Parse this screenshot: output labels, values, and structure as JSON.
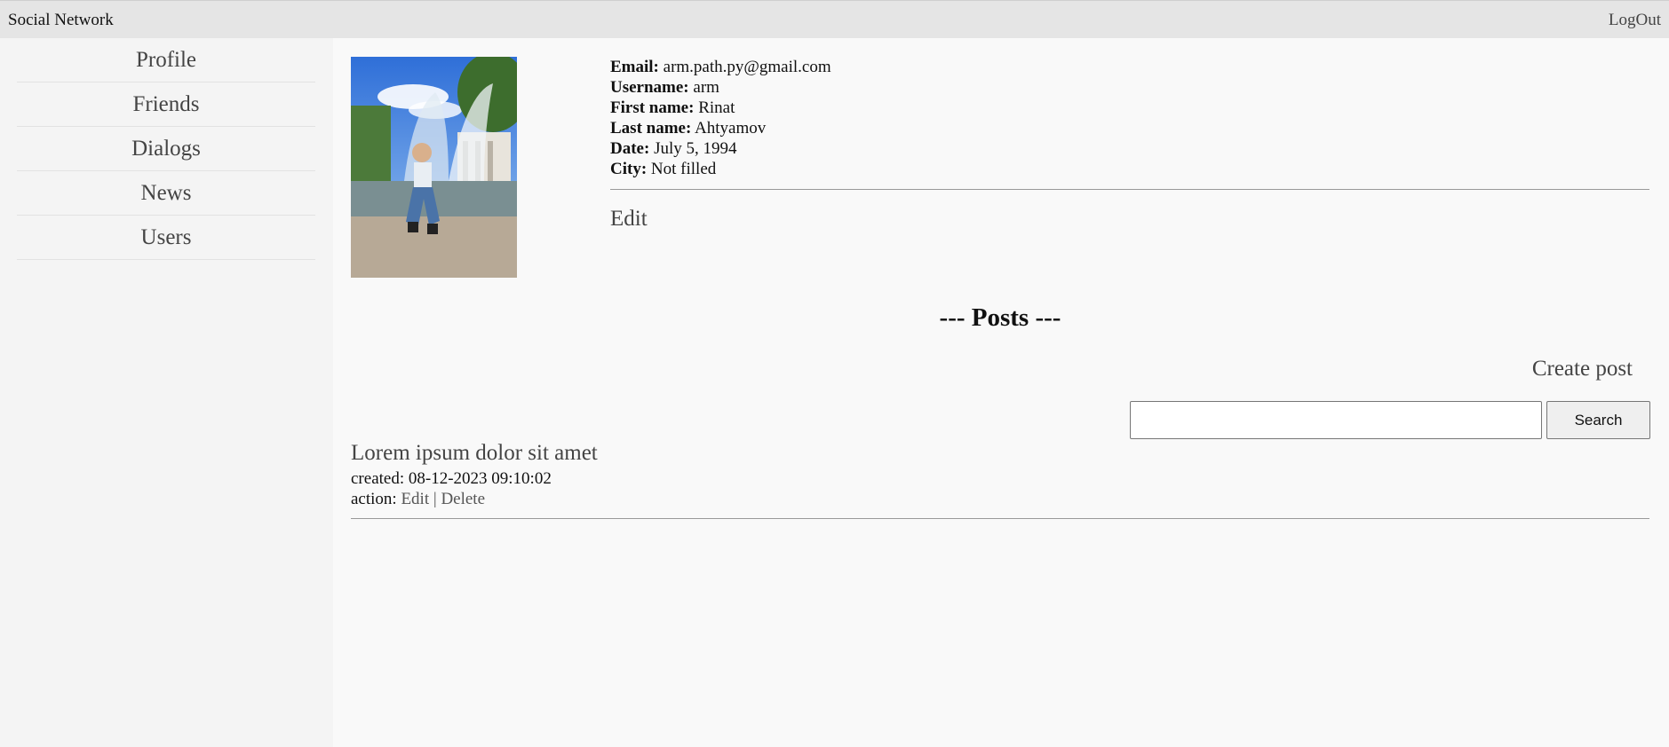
{
  "header": {
    "brand": "Social Network",
    "logout_label": "LogOut"
  },
  "sidebar": {
    "items": [
      {
        "label": "Profile"
      },
      {
        "label": "Friends"
      },
      {
        "label": "Dialogs"
      },
      {
        "label": "News"
      },
      {
        "label": "Users"
      }
    ]
  },
  "profile": {
    "email_label": "Email:",
    "email": "arm.path.py@gmail.com",
    "username_label": "Username:",
    "username": "arm",
    "first_name_label": "First name:",
    "first_name": "Rinat",
    "last_name_label": "Last name:",
    "last_name": "Ahtyamov",
    "date_label": "Date:",
    "date": "July 5, 1994",
    "city_label": "City:",
    "city": "Not filled",
    "edit_label": "Edit"
  },
  "posts": {
    "title": "--- Posts ---",
    "create_label": "Create post",
    "search": {
      "placeholder": "",
      "button_label": "Search"
    },
    "items": [
      {
        "title": "Lorem ipsum dolor sit amet",
        "created_label": "created:",
        "created": "08-12-2023 09:10:02",
        "action_label": "action:",
        "edit_label": "Edit",
        "separator": "|",
        "delete_label": "Delete"
      }
    ]
  }
}
